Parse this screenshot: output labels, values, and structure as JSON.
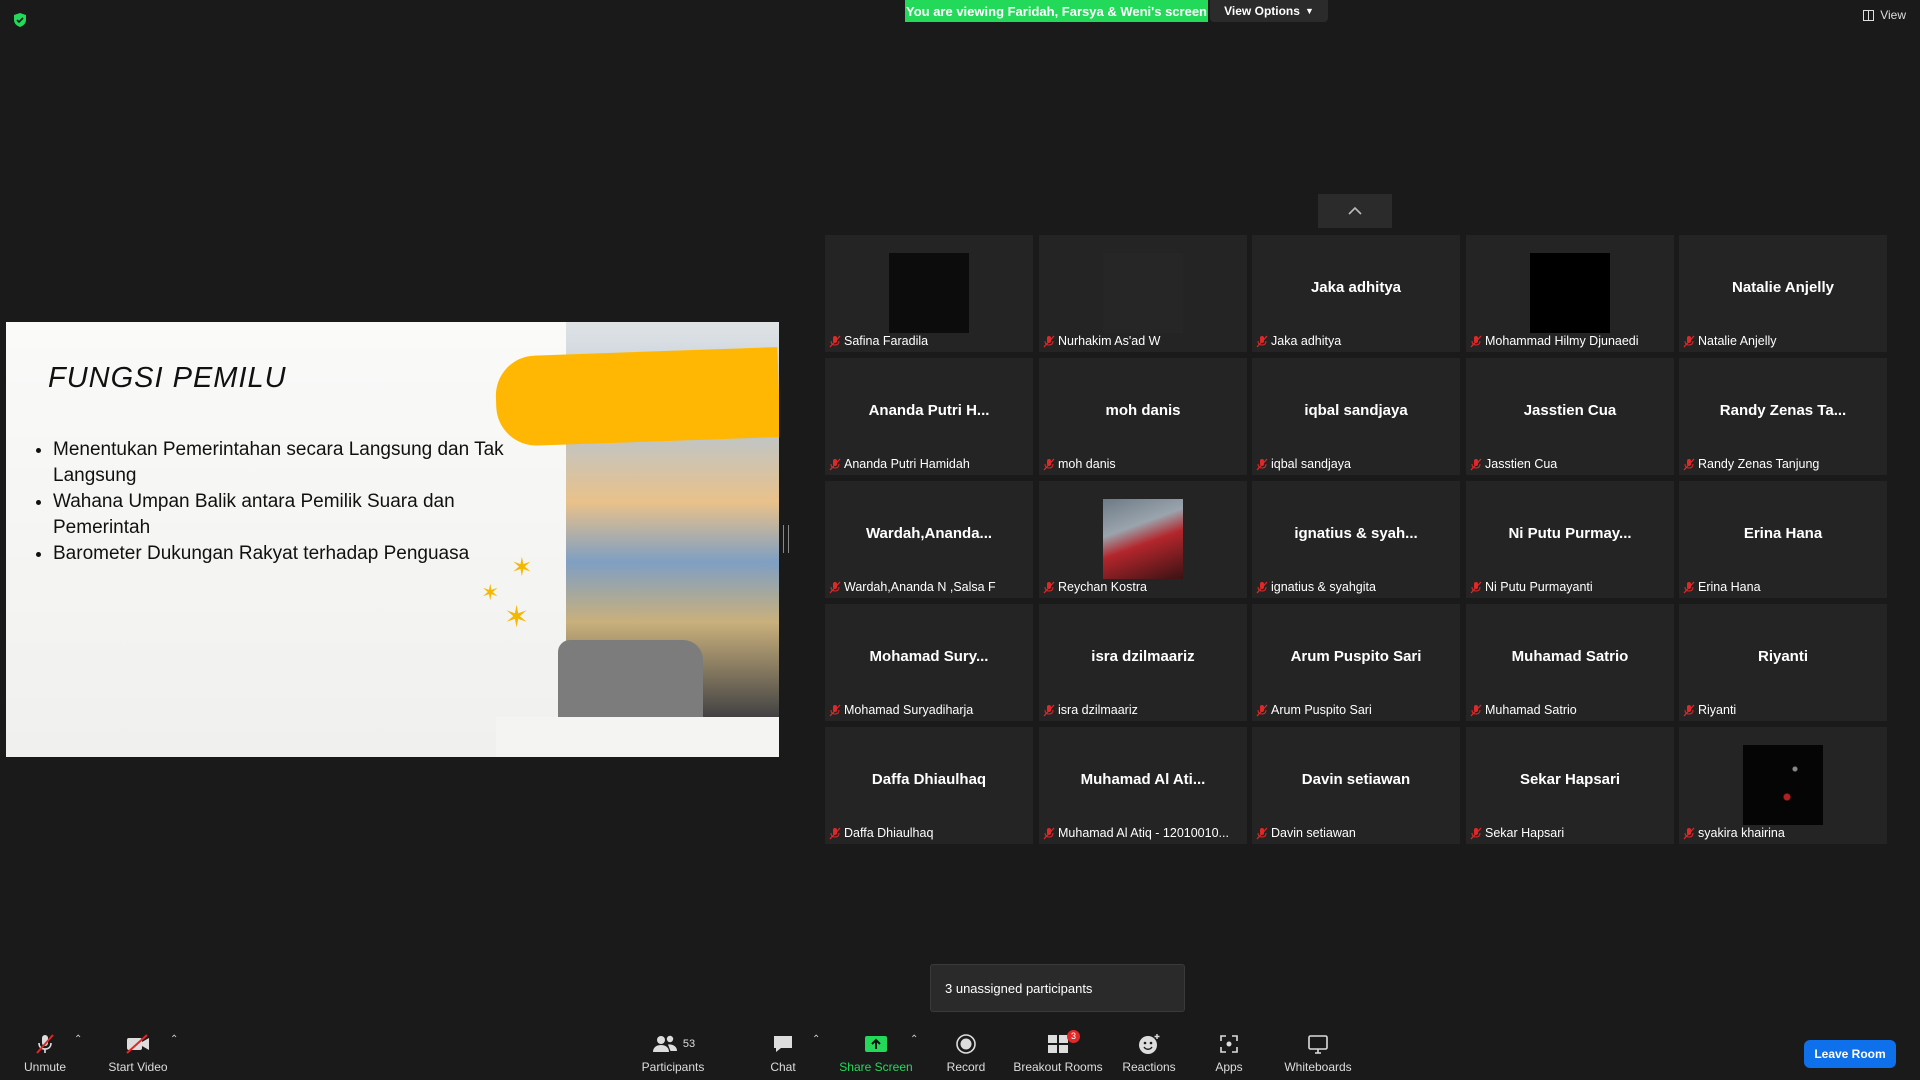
{
  "banner": {
    "text": "You are viewing Faridah, Farsya & Weni's screen"
  },
  "view_options": {
    "label": "View Options"
  },
  "view_button": {
    "label": "View"
  },
  "slide": {
    "title": "FUNGSI PEMILU",
    "bullets": [
      "Menentukan Pemerintahan secara Langsung dan Tak Langsung",
      "Wahana Umpan Balik antara Pemilik Suara dan Pemerintah",
      "Barometer Dukungan Rakyat terhadap Penguasa"
    ]
  },
  "tiles": [
    {
      "big": "",
      "name": "Safina Faradila",
      "pic": "dark"
    },
    {
      "big": "",
      "name": "Nurhakim As'ad W",
      "pic": "none"
    },
    {
      "big": "Jaka adhitya",
      "name": "Jaka adhitya",
      "pic": ""
    },
    {
      "big": "",
      "name": "Mohammad Hilmy Djunaedi",
      "pic": "black"
    },
    {
      "big": "Natalie Anjelly",
      "name": "Natalie Anjelly",
      "pic": ""
    },
    {
      "big": "Ananda Putri H...",
      "name": "Ananda Putri Hamidah",
      "pic": ""
    },
    {
      "big": "moh danis",
      "name": "moh danis",
      "pic": ""
    },
    {
      "big": "iqbal sandjaya",
      "name": "iqbal sandjaya",
      "pic": ""
    },
    {
      "big": "Jasstien Cua",
      "name": "Jasstien Cua",
      "pic": ""
    },
    {
      "big": "Randy Zenas Ta...",
      "name": "Randy Zenas Tanjung",
      "pic": ""
    },
    {
      "big": "Wardah,Ananda...",
      "name": "Wardah,Ananda N ,Salsa F",
      "pic": ""
    },
    {
      "big": "",
      "name": "Reychan Kostra",
      "pic": "photo"
    },
    {
      "big": "ignatius & syah...",
      "name": "ignatius & syahgita",
      "pic": ""
    },
    {
      "big": "Ni Putu Purmay...",
      "name": "Ni Putu Purmayanti",
      "pic": ""
    },
    {
      "big": "Erina Hana",
      "name": "Erina Hana",
      "pic": ""
    },
    {
      "big": "Mohamad Sury...",
      "name": "Mohamad Suryadiharja",
      "pic": ""
    },
    {
      "big": "isra dzilmaariz",
      "name": "isra dzilmaariz",
      "pic": ""
    },
    {
      "big": "Arum Puspito Sari",
      "name": "Arum Puspito Sari",
      "pic": ""
    },
    {
      "big": "Muhamad Satrio",
      "name": "Muhamad Satrio",
      "pic": ""
    },
    {
      "big": "Riyanti",
      "name": "Riyanti",
      "pic": ""
    },
    {
      "big": "Daffa Dhiaulhaq",
      "name": "Daffa Dhiaulhaq",
      "pic": ""
    },
    {
      "big": "Muhamad Al Ati...",
      "name": "Muhamad Al Atiq - 12010010...",
      "pic": ""
    },
    {
      "big": "Davin setiawan",
      "name": "Davin setiawan",
      "pic": ""
    },
    {
      "big": "Sekar Hapsari",
      "name": "Sekar Hapsari",
      "pic": ""
    },
    {
      "big": "",
      "name": "syakira khairina",
      "pic": "space"
    }
  ],
  "tooltip": {
    "text": "3 unassigned participants"
  },
  "toolbar": {
    "unmute": "Unmute",
    "start_video": "Start Video",
    "participants": "Participants",
    "participants_count": "53",
    "chat": "Chat",
    "share_screen": "Share Screen",
    "record": "Record",
    "breakout_rooms": "Breakout Rooms",
    "breakout_badge": "3",
    "reactions": "Reactions",
    "apps": "Apps",
    "whiteboards": "Whiteboards",
    "leave": "Leave Room"
  },
  "colors": {
    "accent_green": "#23d959",
    "leave_blue": "#0e71eb",
    "tile_bg": "#242424",
    "slide_yellow": "#ffb703"
  }
}
